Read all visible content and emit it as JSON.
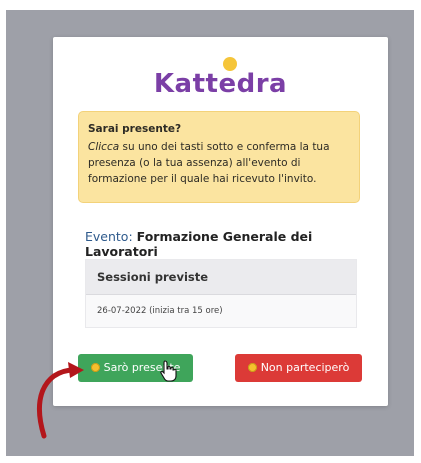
{
  "brand": {
    "logo_text": "Kattedra",
    "accent_yellow": "#f5c53a",
    "accent_purple": "#7b3fa6",
    "accent_green": "#7ac943"
  },
  "alert": {
    "title": "Sarai presente?",
    "body_italic": "Clicca",
    "body_rest": " su uno dei tasti sotto e conferma la tua presenza (o la tua assenza) all'evento di formazione per il quale hai ricevuto l'invito."
  },
  "event": {
    "label": "Evento:",
    "name": "Formazione Generale dei Lavoratori"
  },
  "sessions": {
    "header": "Sessioni previste",
    "rows": [
      "26-07-2022 (inizia tra 15 ore)"
    ]
  },
  "buttons": {
    "yes_label": "Sarò presente",
    "no_label": "Non parteciperò",
    "yes_color": "#3fa55b",
    "no_color": "#dc3a37"
  },
  "icons": {
    "yes_icon": "smiley-emoji",
    "no_icon": "sad-emoji",
    "cursor": "hand-pointer-cursor",
    "annotation": "red-curved-arrow"
  }
}
